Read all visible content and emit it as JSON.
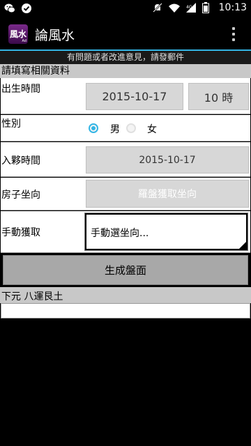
{
  "status_bar": {
    "time": "10:13",
    "left_icons": [
      "wechat-icon",
      "check-circle-icon"
    ],
    "right_icons": [
      "no-notification-icon",
      "wifi-icon",
      "signal-icon",
      "battery-icon"
    ]
  },
  "action_bar": {
    "app_icon_text": "風水",
    "app_icon_badge": "Ad",
    "title": "論風水",
    "menu": "overflow-menu-icon"
  },
  "notice": "有問題或者改進意見，請發郵件",
  "form": {
    "header": "請填寫相關資料",
    "birth": {
      "label": "出生時間",
      "date": "2015-10-17",
      "hour": "10 時"
    },
    "gender": {
      "label": "性別",
      "options": [
        "男",
        "女"
      ],
      "selected": "男"
    },
    "move_in": {
      "label": "入夥時間",
      "date": "2015-10-17"
    },
    "orientation": {
      "label": "房子坐向",
      "compass_button": "羅盤獲取坐向"
    },
    "manual": {
      "label": "手動獲取",
      "spinner_value": "手動選坐向..."
    },
    "generate_button": "生成盤面"
  },
  "result": {
    "label": "下元 八運艮土",
    "value": ""
  },
  "colors": {
    "accent": "#33b5e5",
    "header_bg": "#c8c8c8",
    "button_bg": "#d7d7d7"
  }
}
